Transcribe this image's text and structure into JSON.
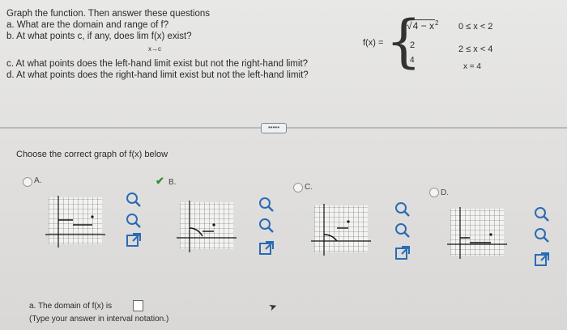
{
  "question": {
    "intro": "Graph the function. Then answer these questions",
    "a": "a. What are the domain and range of f?",
    "b": "b. At what points c, if any, does  lim f(x) exist?",
    "b_sub": "x→c",
    "c": "c. At what points does the left-hand limit exist but not the right-hand limit?",
    "d": "d. At what points does the right-hand limit exist but not the left-hand limit?"
  },
  "function": {
    "name": "f(x) =",
    "pieces": [
      {
        "expr_root": "4 − x",
        "expr_sup": "2",
        "expr_prefix": "√",
        "cond": "0 ≤ x < 2"
      },
      {
        "expr": "2",
        "cond": "2 ≤ x < 4"
      },
      {
        "expr": "4",
        "cond": "x = 4"
      }
    ]
  },
  "more_button": "•••••",
  "choose_prompt": "Choose the correct graph of f(x) below",
  "options": [
    {
      "label": "A.",
      "selected": false
    },
    {
      "label": "B.",
      "selected": true
    },
    {
      "label": "C.",
      "selected": false
    },
    {
      "label": "D.",
      "selected": false
    }
  ],
  "graph_axis": {
    "y_top": "6",
    "y_label": "y",
    "x_label": "x",
    "y_bottom": "-2"
  },
  "answer_a": {
    "label": "a. The domain of f(x) is",
    "hint": "(Type your answer in interval notation.)",
    "value": ""
  },
  "colors": {
    "check": "#2f8f35",
    "icon": "#2b6bb5"
  }
}
